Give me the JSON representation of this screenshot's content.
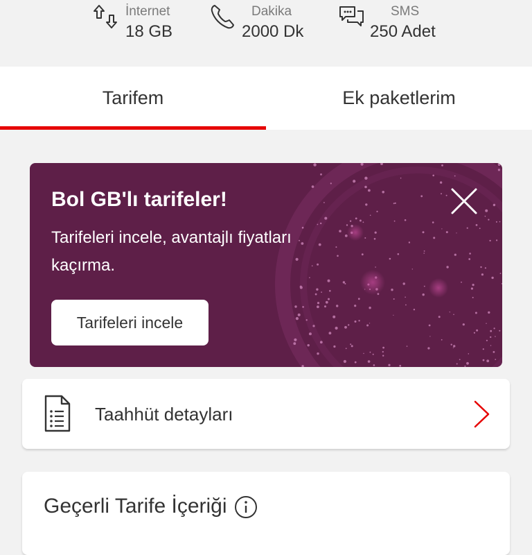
{
  "summary": {
    "internet": {
      "label": "İnternet",
      "value": "18 GB",
      "icon": "data-transfer-icon"
    },
    "minutes": {
      "label": "Dakika",
      "value": "2000 Dk",
      "icon": "phone-icon"
    },
    "sms": {
      "label": "SMS",
      "value": "250 Adet",
      "icon": "message-icon"
    }
  },
  "tabs": [
    {
      "label": "Tarifem",
      "active": true
    },
    {
      "label": "Ek paketlerim",
      "active": false
    }
  ],
  "promo": {
    "title": "Bol GB'lı tarifeler!",
    "text": "Tarifeleri incele, avantajlı fiyatları kaçırma.",
    "button_label": "Tarifeleri incele",
    "background_color": "#5e1f48"
  },
  "commitment": {
    "label": "Taahhüt detayları"
  },
  "tariff_content": {
    "title": "Geçerli Tarife İçeriği"
  },
  "colors": {
    "accent": "#e60000",
    "promo": "#5e1f48",
    "text": "#333333"
  }
}
